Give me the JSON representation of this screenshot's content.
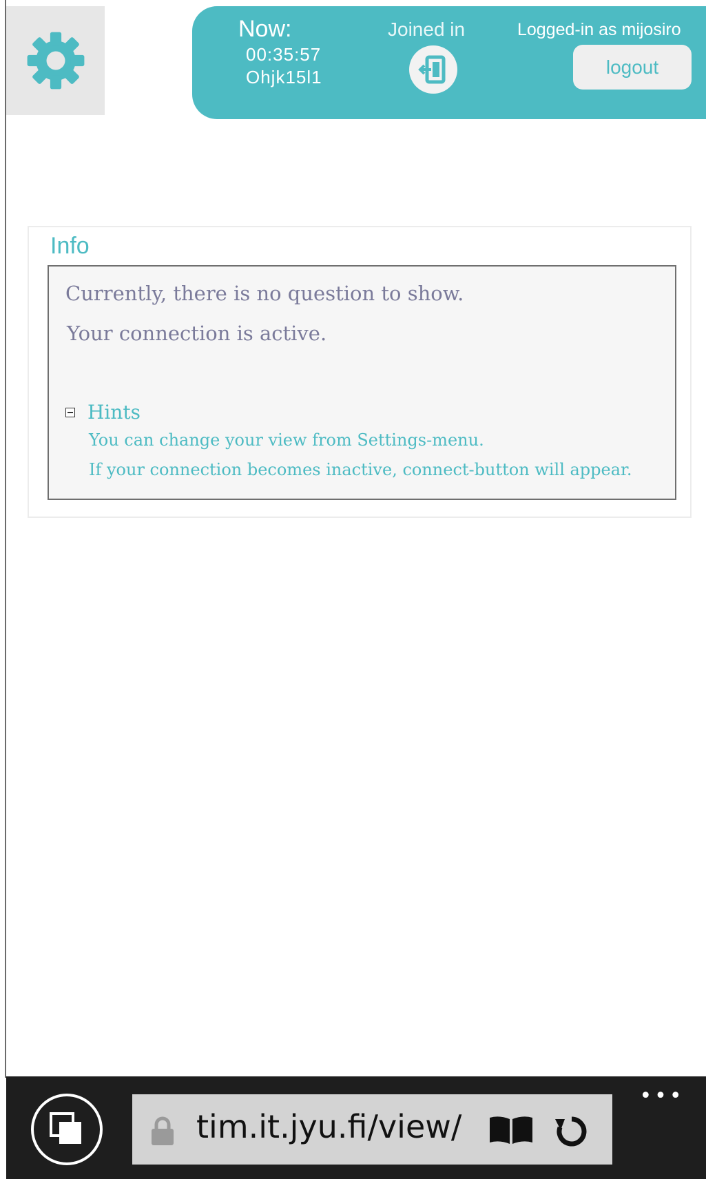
{
  "header": {
    "now_label": "Now:",
    "time": "00:35:57",
    "lecture_code": "Ohjk15l1",
    "joined_label": "Joined in",
    "logged_in_text": "Logged-in as mijosiro",
    "logout_label": "logout",
    "accent_color": "#4dbbc3"
  },
  "info": {
    "title": "Info",
    "messages": [
      "Currently, there is no question to show.",
      "Your connection is active."
    ],
    "hints": {
      "label": "Hints",
      "toggle_symbol": "minus",
      "items": [
        "You can change your view from Settings-menu.",
        "If your connection becomes inactive, connect-button will appear."
      ]
    }
  },
  "browser": {
    "url": "tim.it.jyu.fi/view/",
    "more_label": "•••",
    "icons": [
      "tabs-icon",
      "lock-icon",
      "reading-view-icon",
      "refresh-icon",
      "more-icon"
    ]
  },
  "icons": {
    "settings": "gear-icon",
    "leave": "exit-icon"
  }
}
